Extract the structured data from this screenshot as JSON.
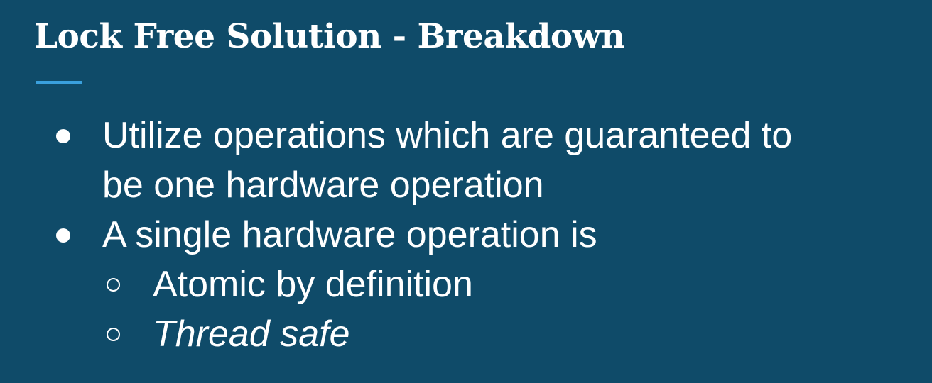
{
  "slide": {
    "title": "Lock Free Solution - Breakdown",
    "accent_color": "#3aa0dd",
    "background_color": "#0f4b69",
    "bullets": [
      {
        "lines": [
          "Utilize operations which are guaranteed to",
          "be one hardware operation"
        ]
      },
      {
        "lines": [
          "A single hardware operation is"
        ],
        "sub_items": [
          {
            "text": "Atomic by definition",
            "italic": false
          },
          {
            "text": "Thread safe",
            "italic": true
          }
        ]
      }
    ]
  }
}
